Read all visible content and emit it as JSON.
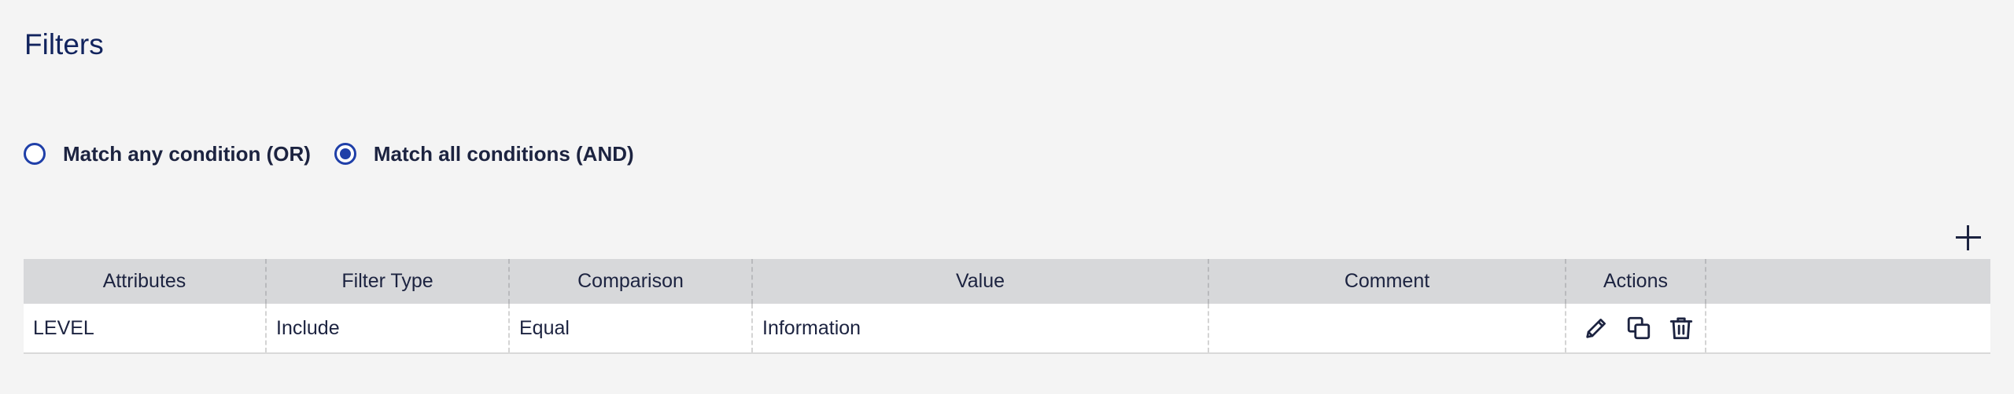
{
  "header": {
    "title": "Filters"
  },
  "match_mode": {
    "options": [
      {
        "label": "Match any condition (OR)",
        "selected": false
      },
      {
        "label": "Match all conditions (AND)",
        "selected": true
      }
    ]
  },
  "toolbar": {
    "add_icon": "plus-icon"
  },
  "table": {
    "columns": [
      "Attributes",
      "Filter Type",
      "Comparison",
      "Value",
      "Comment",
      "Actions",
      ""
    ],
    "rows": [
      {
        "attribute": "LEVEL",
        "filter_type": "Include",
        "comparison": "Equal",
        "value": "Information",
        "comment": "",
        "actions": [
          "pencil-icon",
          "copy-icon",
          "trash-icon"
        ]
      }
    ]
  },
  "colors": {
    "accent": "#1f3fa8",
    "title": "#12245e",
    "header_bg": "#d7d8da",
    "page_bg": "#f4f4f4"
  }
}
